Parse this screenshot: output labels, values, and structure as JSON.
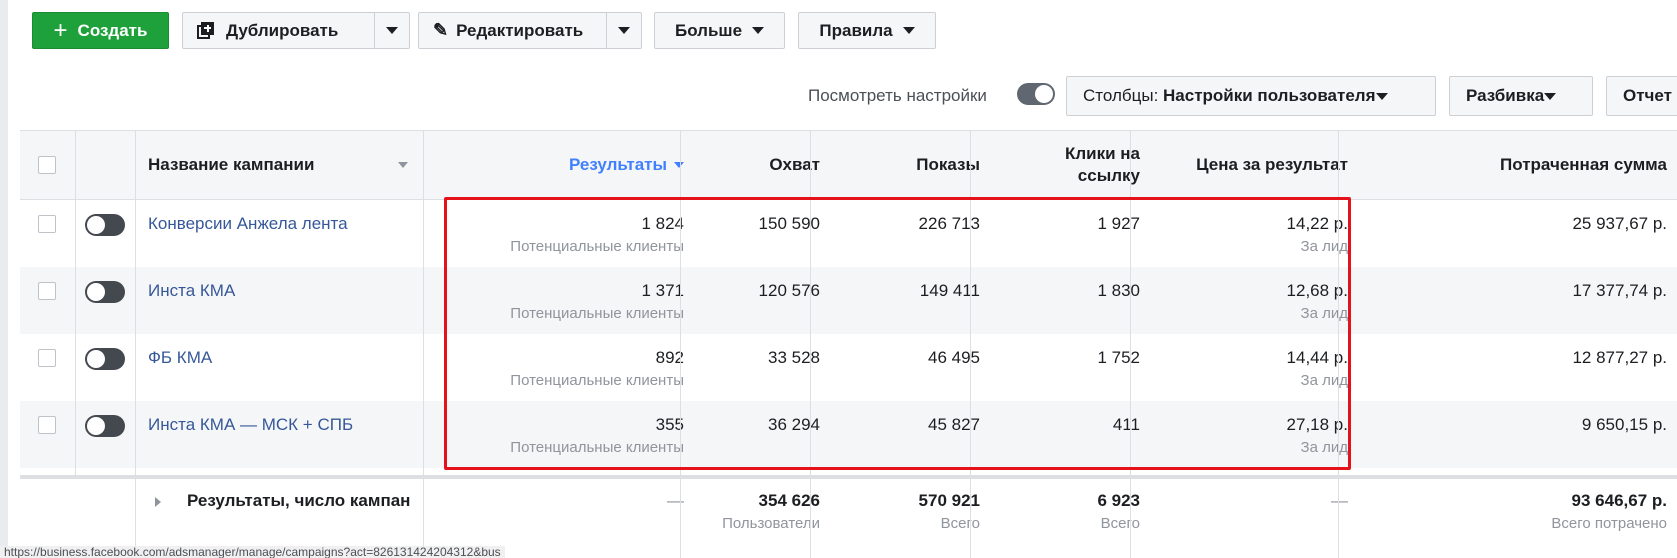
{
  "toolbar": {
    "create_label": "Создать",
    "duplicate_label": "Дублировать",
    "edit_label": "Редактировать",
    "more_label": "Больше",
    "rules_label": "Правила"
  },
  "viewbar": {
    "view_settings_label": "Посмотреть настройки",
    "columns_prefix": "Столбцы: ",
    "columns_value": "Настройки пользователя",
    "breakdown_label": "Разбивка",
    "reports_label": "Отчет"
  },
  "table": {
    "headers": {
      "name": "Название кампании",
      "results": "Результаты",
      "reach": "Охват",
      "impressions": "Показы",
      "clicks_line1": "Клики на",
      "clicks_line2": "ссылку",
      "cost_per_result": "Цена за результат",
      "spent": "Потраченная сумма"
    },
    "rows": [
      {
        "name": "Конверсии Анжела лента",
        "results": "1 824",
        "results_sub": "Потенциальные клиенты",
        "reach": "150 590",
        "impressions": "226 713",
        "clicks": "1 927",
        "cost": "14,22 р.",
        "cost_sub": "За лид",
        "spent": "25 937,67 р."
      },
      {
        "name": "Инста КМА",
        "results": "1 371",
        "results_sub": "Потенциальные клиенты",
        "reach": "120 576",
        "impressions": "149 411",
        "clicks": "1 830",
        "cost": "12,68 р.",
        "cost_sub": "За лид",
        "spent": "17 377,74 р."
      },
      {
        "name": "ФБ КМА",
        "results": "892",
        "results_sub": "Потенциальные клиенты",
        "reach": "33 528",
        "impressions": "46 495",
        "clicks": "1 752",
        "cost": "14,44 р.",
        "cost_sub": "За лид",
        "spent": "12 877,27 р."
      },
      {
        "name": "Инста КМА — МСК + СПБ",
        "results": "355",
        "results_sub": "Потенциальные клиенты",
        "reach": "36 294",
        "impressions": "45 827",
        "clicks": "411",
        "cost": "27,18 р.",
        "cost_sub": "За лид",
        "spent": "9 650,15 р."
      }
    ],
    "totals": {
      "label": "Результаты, число кампан",
      "results": "—",
      "reach": "354 626",
      "reach_sub": "Пользователи",
      "impressions": "570 921",
      "impressions_sub": "Всего",
      "clicks": "6 923",
      "clicks_sub": "Всего",
      "cost": "—",
      "spent": "93 646,67 р.",
      "spent_sub": "Всего потрачено"
    }
  },
  "status_url": "https://business.facebook.com/adsmanager/manage/campaigns?act=826131424204312&bus",
  "colors": {
    "create": "#1ea13a",
    "link": "#365899",
    "highlight": "#e5121c",
    "sort_header": "#4080ff"
  }
}
